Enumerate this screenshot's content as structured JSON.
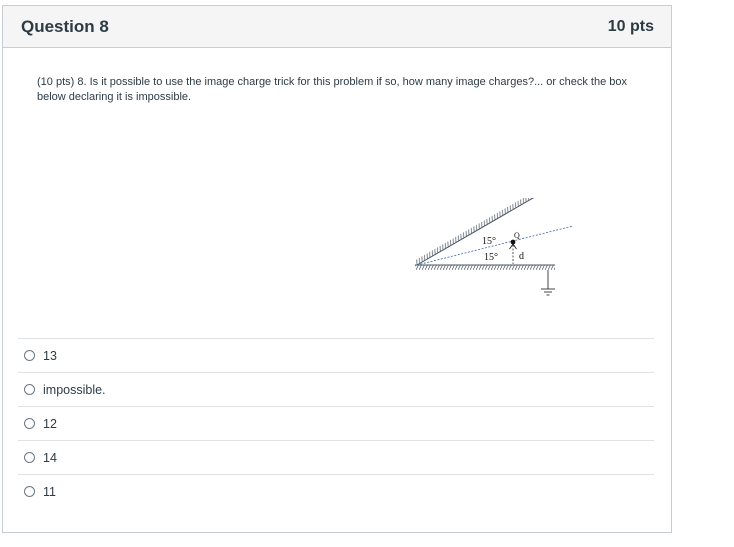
{
  "question": {
    "title": "Question 8",
    "points": "10 pts",
    "text": "(10 pts) 8. Is it possible to use the image charge trick for this problem if so, how many image charges?... or check the box below declaring it is impossible."
  },
  "figure": {
    "angle_upper": "15°",
    "angle_lower": "15°",
    "charge_label": "Q",
    "distance_label": "d"
  },
  "answers": [
    {
      "label": "13"
    },
    {
      "label": "impossible."
    },
    {
      "label": "12"
    },
    {
      "label": "14"
    },
    {
      "label": "11"
    }
  ]
}
